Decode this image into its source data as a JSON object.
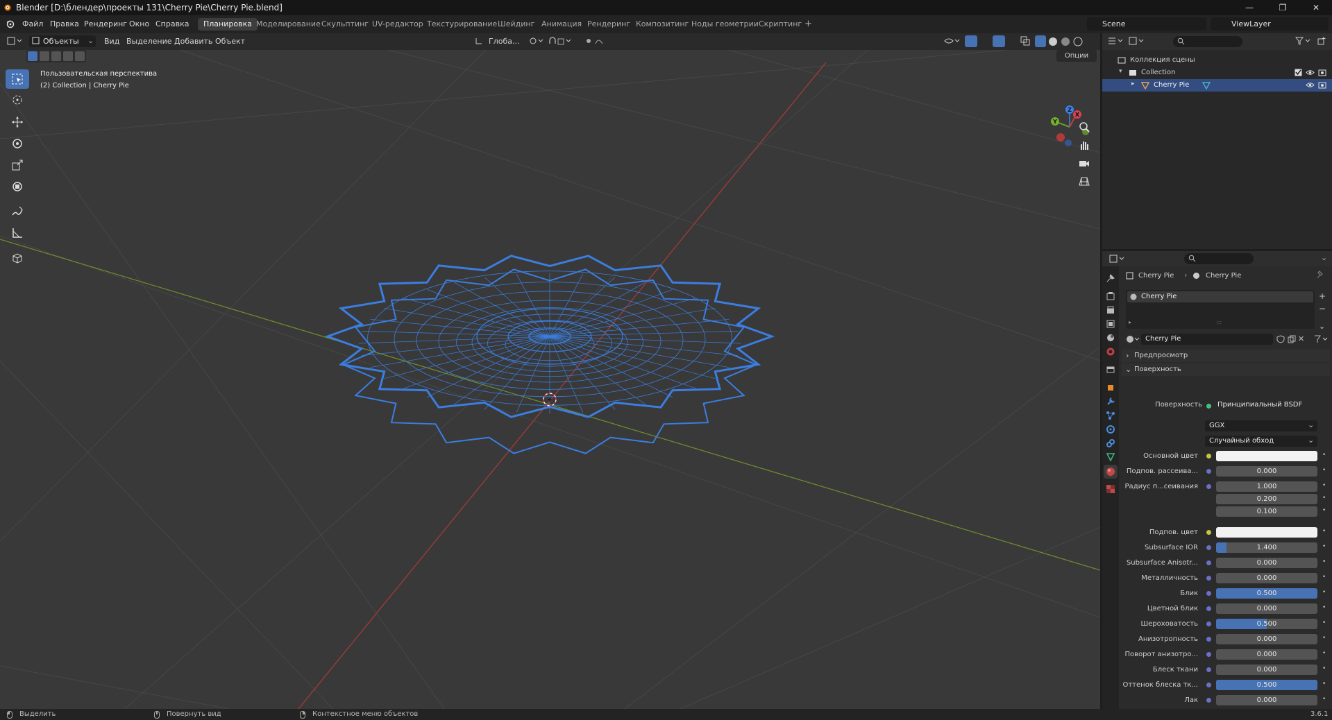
{
  "titlebar": {
    "title": "Blender [D:\\блендер\\проекты 131\\Cherry Pie\\Cherry Pie.blend]",
    "min": "—",
    "max": "❐",
    "close": "✕"
  },
  "menu": [
    "Файл",
    "Правка",
    "Рендеринг",
    "Окно",
    "Справка"
  ],
  "workspaces": [
    "Планировка",
    "Моделирование",
    "Скульптинг",
    "UV-редактор",
    "Текстурирование",
    "Шейдинг",
    "Анимация",
    "Рендеринг",
    "Композитинг",
    "Ноды геометрии",
    "Скриптинг"
  ],
  "active_workspace": "Планировка",
  "scene": {
    "label": "Scene",
    "view_layer": "ViewLayer"
  },
  "viewport_header": {
    "mode": "Объекты",
    "menus": [
      "Вид",
      "Выделение",
      "Добавить",
      "Объект"
    ],
    "transform_orientation": "Глоба...",
    "options": "Опции"
  },
  "viewport": {
    "perspective": "Пользовательская перспектива",
    "collection": "(2) Collection | Cherry Pie",
    "gizmo": {
      "x": "X",
      "y": "Y",
      "z": "Z"
    }
  },
  "outliner": {
    "scene_collection": "Коллекция сцены",
    "collection": "Collection",
    "object": "Cherry Pie"
  },
  "properties": {
    "breadcrumb_object": "Cherry Pie",
    "breadcrumb_material": "Cherry Pie",
    "slot": "Cherry Pie",
    "material_name": "Cherry Pie",
    "preview_panel": "Предпросмотр",
    "surface_panel": "Поверхность",
    "surface_label": "Поверхность",
    "surface_value": "Принципиальный BSDF",
    "distribution": "GGX",
    "subsurface_method": "Случайный обход",
    "rows": [
      {
        "label": "Основной цвет",
        "value": "",
        "type": "color",
        "dot": "yellow"
      },
      {
        "label": "Подпов. рассеива...",
        "value": "0.000",
        "type": "num",
        "dot": "blue",
        "fill": 0
      },
      {
        "label": "Радиус п...сеивания",
        "value": "1.000",
        "type": "num",
        "dot": "blue",
        "fill": 0
      },
      {
        "label": "",
        "value": "0.200",
        "type": "num",
        "dot": "",
        "fill": 0
      },
      {
        "label": "",
        "value": "0.100",
        "type": "num",
        "dot": "",
        "fill": 0
      },
      {
        "label": "Подпов. цвет",
        "value": "",
        "type": "color",
        "dot": "yellow"
      },
      {
        "label": "Subsurface IOR",
        "value": "1.400",
        "type": "num",
        "dot": "blue",
        "fill": 0.1
      },
      {
        "label": "Subsurface Anisotr...",
        "value": "0.000",
        "type": "num",
        "dot": "blue",
        "fill": 0
      },
      {
        "label": "Металличность",
        "value": "0.000",
        "type": "num",
        "dot": "blue",
        "fill": 0
      },
      {
        "label": "Блик",
        "value": "0.500",
        "type": "num",
        "dot": "blue",
        "fill": 1
      },
      {
        "label": "Цветной блик",
        "value": "0.000",
        "type": "num",
        "dot": "blue",
        "fill": 0
      },
      {
        "label": "Шероховатость",
        "value": "0.500",
        "type": "num",
        "dot": "blue",
        "fill": 0.5
      },
      {
        "label": "Анизотропность",
        "value": "0.000",
        "type": "num",
        "dot": "blue",
        "fill": 0
      },
      {
        "label": "Поворот анизотро...",
        "value": "0.000",
        "type": "num",
        "dot": "blue",
        "fill": 0
      },
      {
        "label": "Блеск ткани",
        "value": "0.000",
        "type": "num",
        "dot": "blue",
        "fill": 0
      },
      {
        "label": "Оттенок блеска тк...",
        "value": "0.500",
        "type": "num",
        "dot": "blue",
        "fill": 1
      },
      {
        "label": "Лак",
        "value": "0.000",
        "type": "num",
        "dot": "blue",
        "fill": 0
      }
    ]
  },
  "statusbar": {
    "select": "Выделить",
    "rotate": "Повернуть вид",
    "context": "Контекстное меню объектов",
    "version": "3.6.1"
  },
  "colors": {
    "accent": "#4772b3",
    "wire": "#3d7fe0",
    "x_axis": "#b53f3f",
    "y_axis": "#7c9a2f"
  }
}
